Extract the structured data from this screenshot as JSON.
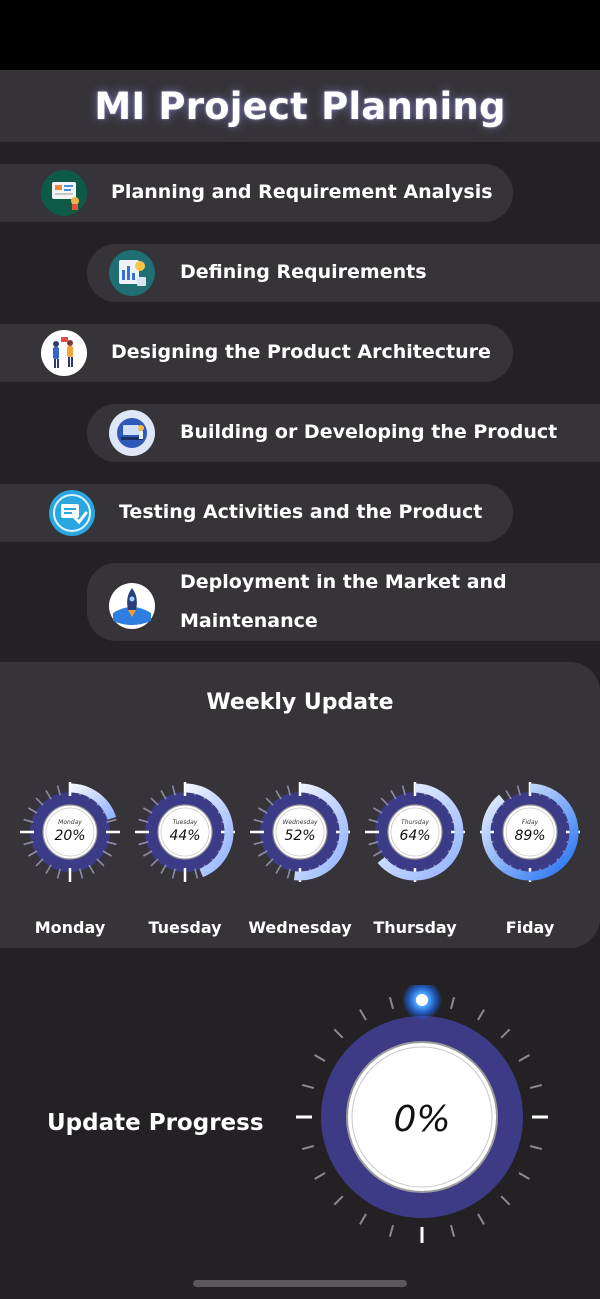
{
  "title": "MI Project Planning",
  "steps": [
    {
      "label": "Planning and Requirement Analysis",
      "icon": "planning-board-icon"
    },
    {
      "label": "Defining Requirements",
      "icon": "requirements-chart-icon"
    },
    {
      "label": "Designing the Product Architecture",
      "icon": "team-design-icon"
    },
    {
      "label": "Building or Developing the Product",
      "icon": "developer-desk-icon"
    },
    {
      "label": "Testing Activities and the Product",
      "icon": "testing-checklist-icon"
    },
    {
      "label": "Deployment in the Market and Maintenance",
      "icon": "rocket-launch-icon"
    }
  ],
  "weekly": {
    "title": "Weekly Update",
    "days": [
      {
        "name": "Monday",
        "dial_label": "Monday",
        "percent": 20,
        "value_text": "20%"
      },
      {
        "name": "Tuesday",
        "dial_label": "Tuesday",
        "percent": 44,
        "value_text": "44%"
      },
      {
        "name": "Wednesday",
        "dial_label": "Wednesday",
        "percent": 52,
        "value_text": "52%"
      },
      {
        "name": "Thursday",
        "dial_label": "Thursday",
        "percent": 64,
        "value_text": "64%"
      },
      {
        "name": "Fiday",
        "dial_label": "Fiday",
        "percent": 89,
        "value_text": "89%"
      }
    ]
  },
  "update_progress": {
    "label": "Update Progress",
    "percent": 0,
    "value_text": "0%"
  },
  "colors": {
    "background": "#232124",
    "panel": "#363438",
    "ring": "#3b3b87",
    "accent_blue": "#2f7cf6",
    "arc_light": "#e6ecff"
  }
}
